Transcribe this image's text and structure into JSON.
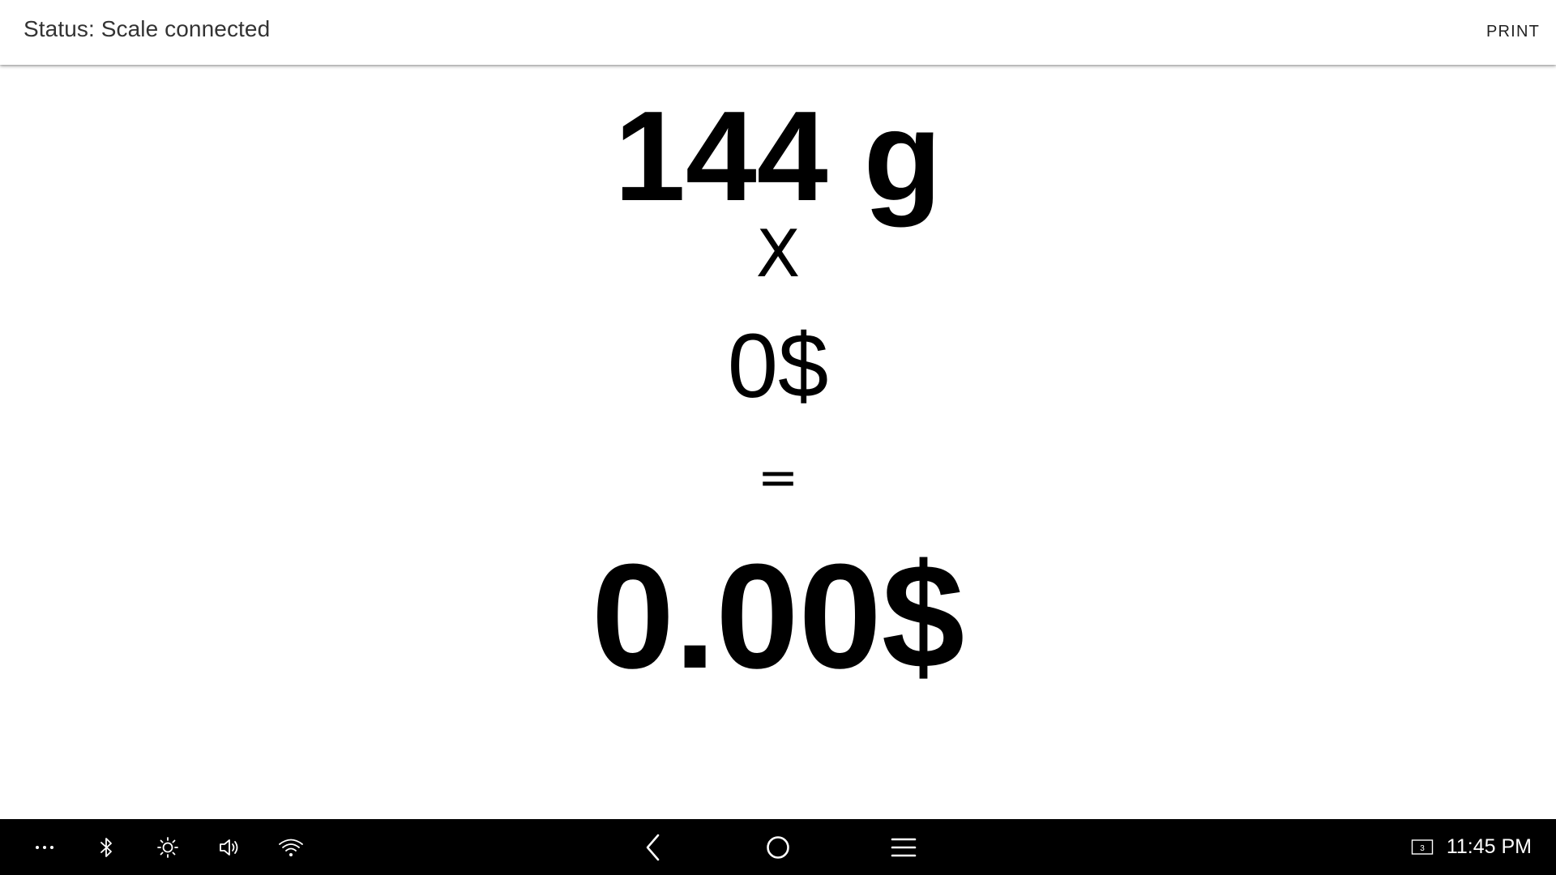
{
  "header": {
    "status_text": "Status: Scale connected",
    "print_label": "PRINT"
  },
  "scale": {
    "weight": "144 g",
    "operator_times": "X",
    "unit_price": "0$",
    "operator_equals": "=",
    "total": "0.00$"
  },
  "navbar": {
    "left_icons": [
      "more-icon",
      "bluetooth-icon",
      "brightness-icon",
      "volume-icon",
      "wifi-icon"
    ],
    "center_icons": [
      "back-icon",
      "home-icon",
      "menu-icon"
    ],
    "screen_badge": "3",
    "clock": "11:45 PM",
    "icon_color": "#ffffff",
    "background": "#000000"
  }
}
